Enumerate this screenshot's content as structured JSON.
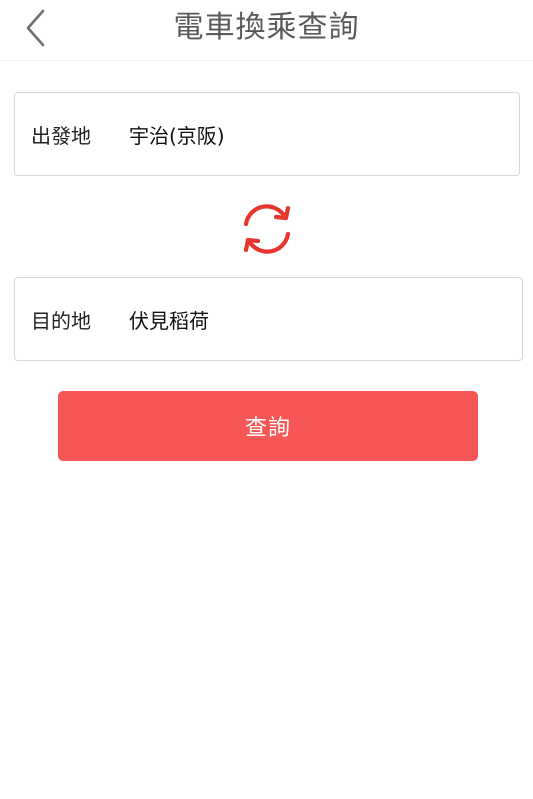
{
  "header": {
    "title": "電車換乘查詢",
    "back_icon": "chevron-left-icon"
  },
  "form": {
    "origin": {
      "label": "出發地",
      "value": "宇治(京阪)"
    },
    "swap_icon": "swap-arrows-icon",
    "destination": {
      "label": "目的地",
      "value": "伏見稻荷"
    },
    "search_label": "查詢"
  },
  "colors": {
    "accent": "#f65655",
    "swap_icon": "#e8362f",
    "title_text": "#5a5a5a",
    "border": "#d8d8d8"
  }
}
